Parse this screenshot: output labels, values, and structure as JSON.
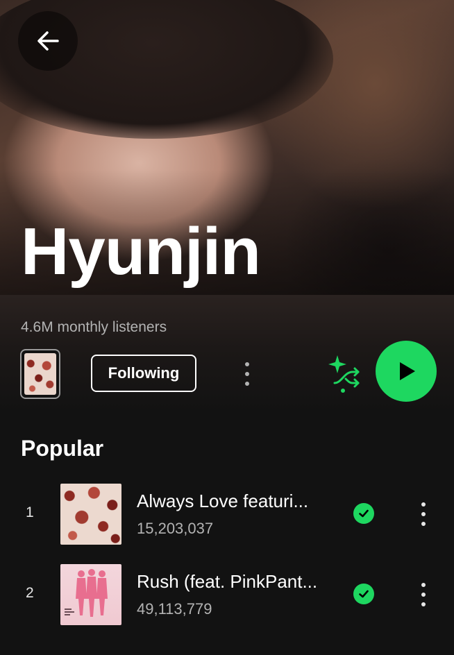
{
  "artist": {
    "name": "Hyunjin",
    "monthly_listeners": "4.6M monthly listeners"
  },
  "actions": {
    "follow_label": "Following"
  },
  "popular": {
    "title": "Popular",
    "tracks": [
      {
        "rank": "1",
        "title": "Always Love featuri...",
        "plays": "15,203,037",
        "saved": true
      },
      {
        "rank": "2",
        "title": "Rush (feat. PinkPant...",
        "plays": "49,113,779",
        "saved": true
      }
    ]
  },
  "colors": {
    "accent_green": "#1ed760",
    "background": "#121212",
    "muted_text": "#b3b3b3"
  },
  "icons": {
    "back": "arrow-left-icon",
    "more": "more-vertical-icon",
    "smart_shuffle": "smart-shuffle-icon",
    "play": "play-icon",
    "saved": "check-circle-icon"
  }
}
